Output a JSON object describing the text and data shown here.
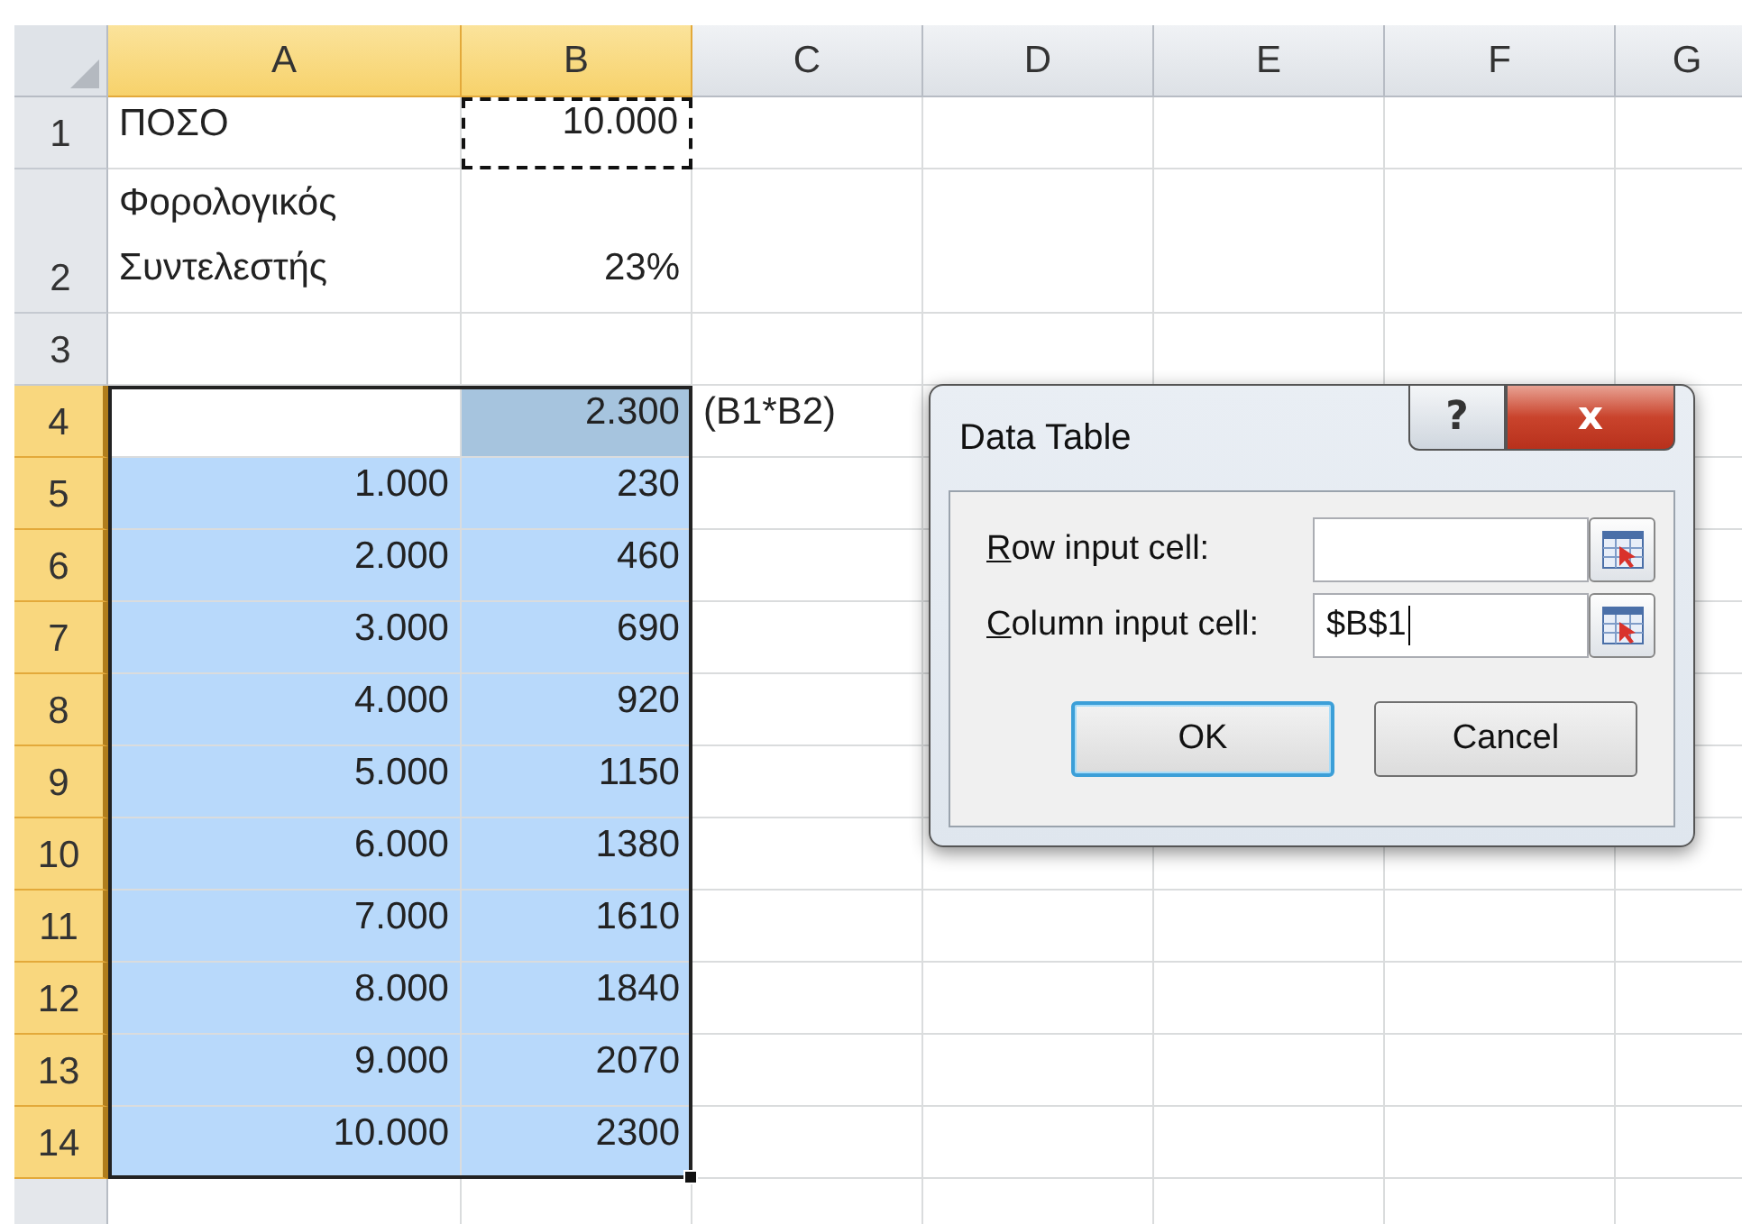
{
  "sheet": {
    "columns": [
      {
        "label": "A",
        "selected": true
      },
      {
        "label": "B",
        "selected": true
      },
      {
        "label": "C",
        "selected": false
      },
      {
        "label": "D",
        "selected": false
      },
      {
        "label": "E",
        "selected": false
      },
      {
        "label": "F",
        "selected": false
      },
      {
        "label": "G",
        "selected": false
      }
    ],
    "rows": [
      {
        "header": "1",
        "selected": false,
        "cells": [
          {
            "text": "ΠΟΣΟ",
            "kind": "plain",
            "numeric": false
          },
          {
            "text": "10.000",
            "kind": "marquee",
            "numeric": true
          }
        ]
      },
      {
        "header": "2",
        "selected": false,
        "tall": true,
        "cells": [
          {
            "text": "Φορολογικός Συντελεστής",
            "kind": "plain",
            "numeric": false
          },
          {
            "text": "23%",
            "kind": "plain",
            "numeric": true
          }
        ]
      },
      {
        "header": "3",
        "selected": false,
        "cells": []
      },
      {
        "header": "4",
        "selected": true,
        "cells": [
          {
            "kind": "active"
          },
          {
            "text": "2.300",
            "kind": "formula",
            "numeric": true
          },
          {
            "text": "(B1*B2)",
            "kind": "plain",
            "numeric": false
          }
        ]
      },
      {
        "header": "5",
        "selected": true,
        "cells": [
          {
            "text": "1.000",
            "kind": "range",
            "numeric": true
          },
          {
            "text": "230",
            "kind": "range",
            "numeric": true
          }
        ]
      },
      {
        "header": "6",
        "selected": true,
        "cells": [
          {
            "text": "2.000",
            "kind": "range",
            "numeric": true
          },
          {
            "text": "460",
            "kind": "range",
            "numeric": true
          }
        ]
      },
      {
        "header": "7",
        "selected": true,
        "cells": [
          {
            "text": "3.000",
            "kind": "range",
            "numeric": true
          },
          {
            "text": "690",
            "kind": "range",
            "numeric": true
          }
        ]
      },
      {
        "header": "8",
        "selected": true,
        "cells": [
          {
            "text": "4.000",
            "kind": "range",
            "numeric": true
          },
          {
            "text": "920",
            "kind": "range",
            "numeric": true
          }
        ]
      },
      {
        "header": "9",
        "selected": true,
        "cells": [
          {
            "text": "5.000",
            "kind": "range",
            "numeric": true
          },
          {
            "text": "1150",
            "kind": "range",
            "numeric": true
          }
        ]
      },
      {
        "header": "10",
        "selected": true,
        "cells": [
          {
            "text": "6.000",
            "kind": "range",
            "numeric": true
          },
          {
            "text": "1380",
            "kind": "range",
            "numeric": true
          }
        ]
      },
      {
        "header": "11",
        "selected": true,
        "cells": [
          {
            "text": "7.000",
            "kind": "range",
            "numeric": true
          },
          {
            "text": "1610",
            "kind": "range",
            "numeric": true
          }
        ]
      },
      {
        "header": "12",
        "selected": true,
        "cells": [
          {
            "text": "8.000",
            "kind": "range",
            "numeric": true
          },
          {
            "text": "1840",
            "kind": "range",
            "numeric": true
          }
        ]
      },
      {
        "header": "13",
        "selected": true,
        "cells": [
          {
            "text": "9.000",
            "kind": "range",
            "numeric": true
          },
          {
            "text": "2070",
            "kind": "range",
            "numeric": true
          }
        ]
      },
      {
        "header": "14",
        "selected": true,
        "cells": [
          {
            "text": "10.000",
            "kind": "range",
            "numeric": true
          },
          {
            "text": "2300",
            "kind": "range",
            "numeric": true
          }
        ]
      }
    ]
  },
  "dialog": {
    "title": "Data Table",
    "help": "?",
    "close": "x",
    "fields": [
      {
        "label": "Row input cell:",
        "focused": false
      },
      {
        "label": "Column input cell:",
        "value": "$B$1",
        "focused": true
      }
    ],
    "buttons": [
      {
        "label": "OK",
        "default": true
      },
      {
        "label": "Cancel",
        "default": false
      }
    ]
  }
}
